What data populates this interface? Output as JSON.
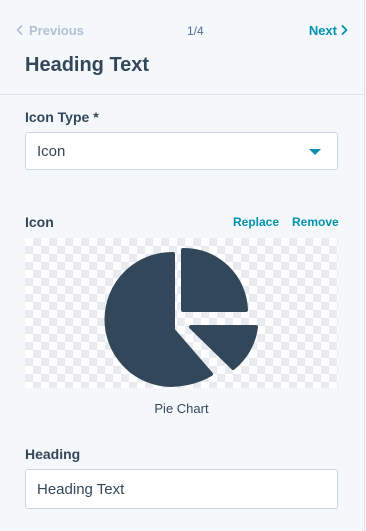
{
  "pager": {
    "previous_label": "Previous",
    "page_indicator": "1/4",
    "next_label": "Next"
  },
  "header": {
    "title": "Heading Text"
  },
  "icon_type": {
    "label": "Icon Type *",
    "selected": "Icon"
  },
  "icon": {
    "label": "Icon",
    "replace_label": "Replace",
    "remove_label": "Remove",
    "preview_icon": "pie-chart-icon",
    "name": "Pie Chart"
  },
  "heading_field": {
    "label": "Heading",
    "value": "Heading Text"
  },
  "colors": {
    "accent": "#0091ae",
    "text": "#33475b",
    "disabled": "#b0c1d4",
    "icon_fill": "#33475b"
  }
}
